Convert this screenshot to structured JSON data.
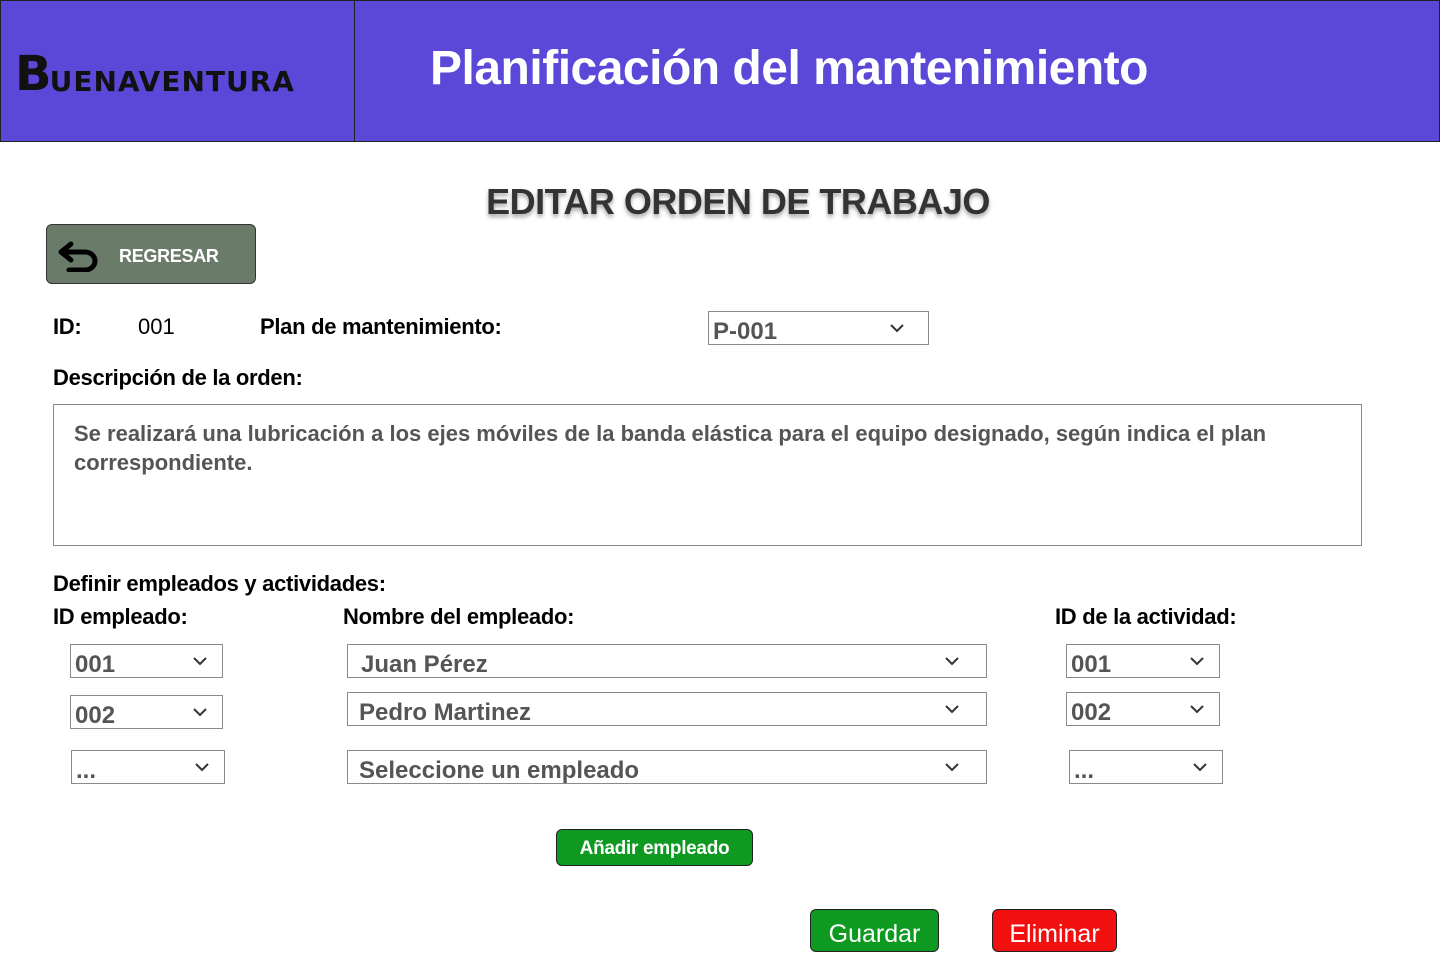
{
  "header": {
    "logo_first": "B",
    "logo_rest": "UENAVENTURA",
    "title": "Planificación del mantenimiento",
    "color": "#5b48d8"
  },
  "page": {
    "title": "EDITAR ORDEN DE TRABAJO"
  },
  "back_button": {
    "label": "REGRESAR",
    "icon": "return-arrow-icon"
  },
  "form": {
    "id_label": "ID:",
    "id_value": "001",
    "plan_label": "Plan de mantenimiento:",
    "plan_value": "P-001",
    "desc_label": "Descripción de la orden:",
    "desc_value": "Se realizará una lubricación a los ejes móviles de la banda elástica para el equipo designado, según indica el plan correspondiente.",
    "assign_label": "Definir empleados y actividades:",
    "col_emp_id": "ID empleado:",
    "col_emp_name": "Nombre del empleado:",
    "col_act_id": "ID de la actividad:",
    "rows": [
      {
        "emp_id": "001",
        "emp_name": "Juan Pérez",
        "act_id": "001"
      },
      {
        "emp_id": "002",
        "emp_name": "Pedro Martinez",
        "act_id": "002"
      },
      {
        "emp_id": "...",
        "emp_name": "Seleccione un empleado",
        "act_id": "..."
      }
    ]
  },
  "buttons": {
    "add_employee": "Añadir empleado",
    "save": "Guardar",
    "delete": "Eliminar",
    "save_color": "#0e9a20",
    "delete_color": "#f20f0f"
  }
}
